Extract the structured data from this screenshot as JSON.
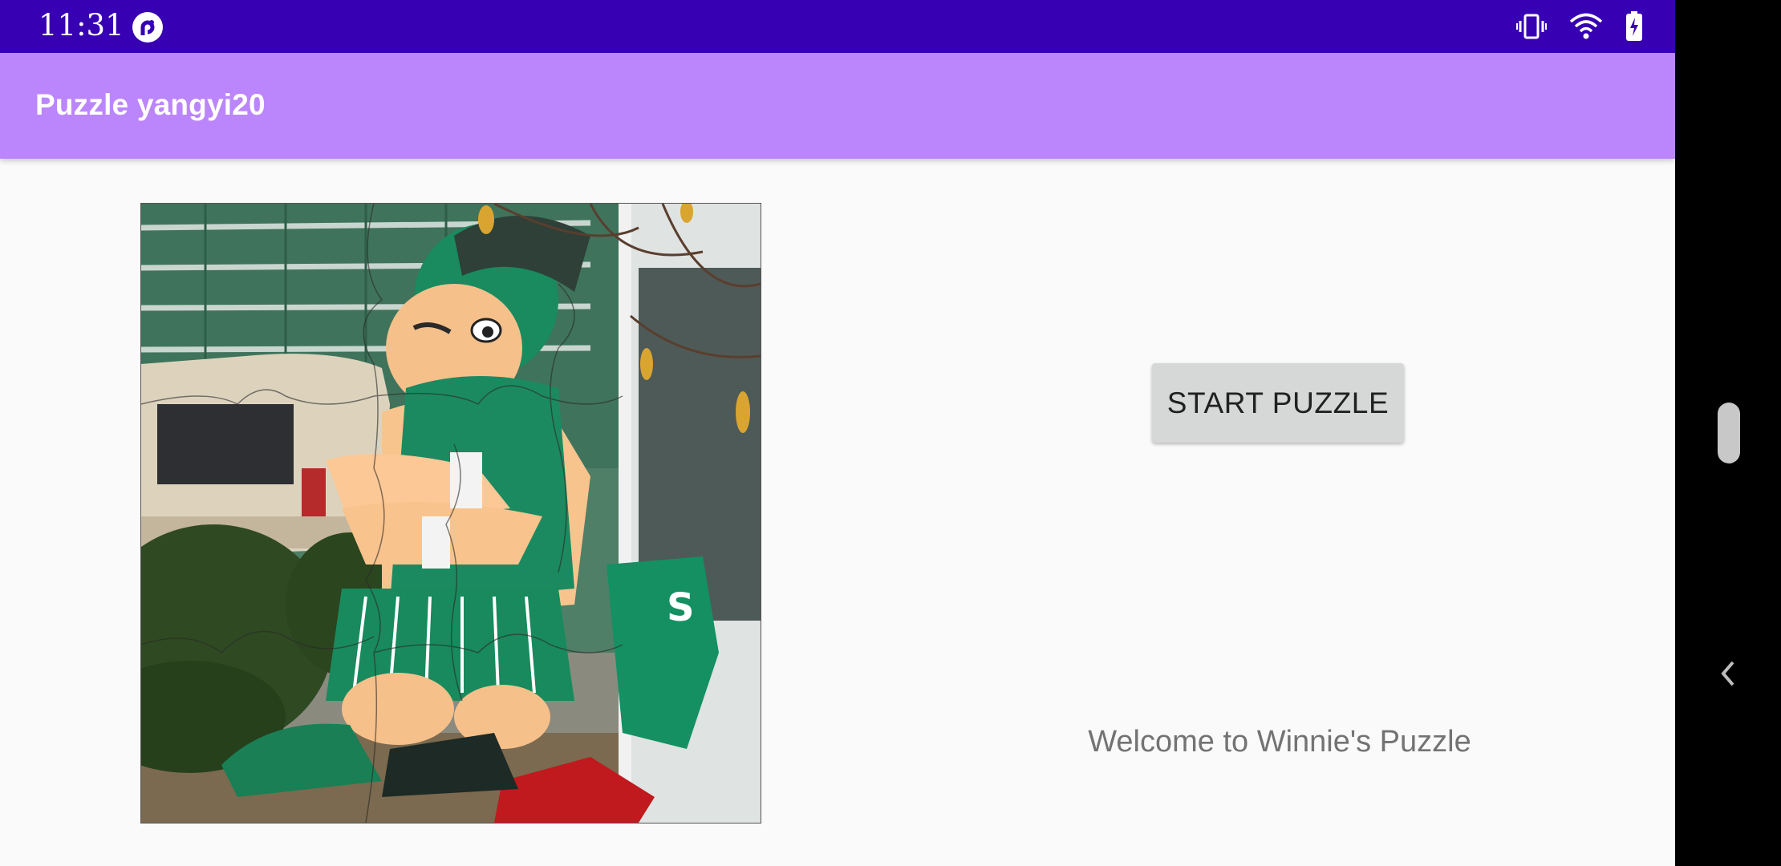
{
  "status_bar": {
    "time": "11:31",
    "app_icon": "pocket-casts-icon",
    "icons": [
      "vibrate-icon",
      "wifi-icon",
      "battery-charging-icon"
    ],
    "background": "#3700b3"
  },
  "app_bar": {
    "title": "Puzzle yangyi20",
    "background": "#bb86fc"
  },
  "main": {
    "puzzle_image": "sparty-mascot-puzzle-image",
    "start_button_label": "START PUZZLE",
    "welcome_text": "Welcome to Winnie's Puzzle"
  },
  "navigation": {
    "icons": [
      "scroll-handle",
      "back-chevron-icon"
    ]
  }
}
